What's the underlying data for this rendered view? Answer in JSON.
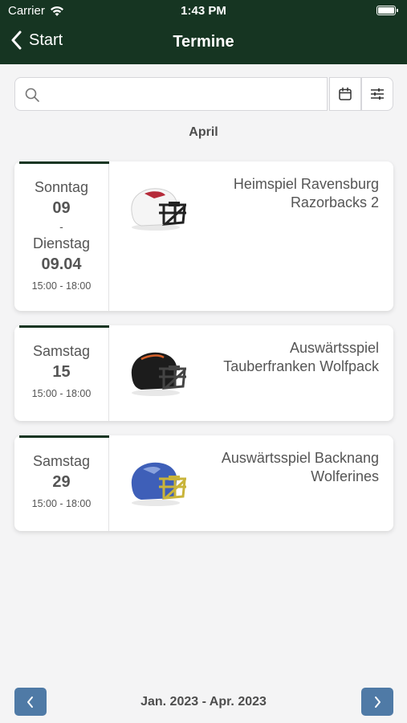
{
  "status": {
    "carrier": "Carrier",
    "time": "1:43 PM"
  },
  "nav": {
    "back_label": "Start",
    "title": "Termine"
  },
  "search": {
    "placeholder": "",
    "value": ""
  },
  "month_header": "April",
  "events": [
    {
      "start_day": "Sonntag",
      "start_num": "09",
      "separator": "-",
      "end_day": "Dienstag",
      "end_num": "09.04",
      "time": "15:00 - 18:00",
      "title": "Heimspiel Ravensburg Razorbacks 2",
      "helmet": "white-red-helmet-icon"
    },
    {
      "start_day": "Samstag",
      "start_num": "15",
      "time": "15:00 - 18:00",
      "title": "Auswärtsspiel Tauberfranken Wolfpack",
      "helmet": "black-helmet-icon"
    },
    {
      "start_day": "Samstag",
      "start_num": "29",
      "time": "15:00 - 18:00",
      "title": "Auswärtsspiel Backnang Wolferines",
      "helmet": "blue-gold-helmet-icon"
    }
  ],
  "footer": {
    "range": "Jan. 2023 - Apr. 2023"
  },
  "colors": {
    "header": "#163522",
    "pager": "#4f7aa6",
    "background": "#f4f4f5"
  }
}
